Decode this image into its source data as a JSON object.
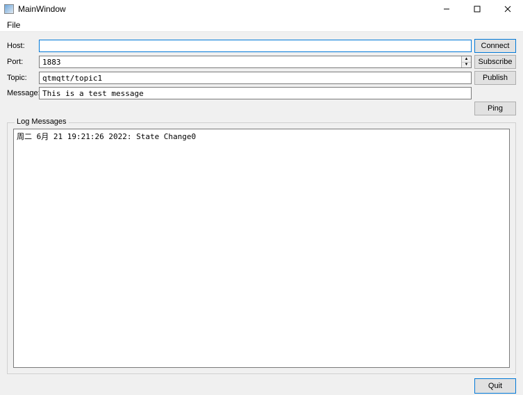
{
  "window": {
    "title": "MainWindow",
    "menu": {
      "file": "File"
    }
  },
  "form": {
    "host": {
      "label": "Host:",
      "value": ""
    },
    "port": {
      "label": "Port:",
      "value": "1883"
    },
    "topic": {
      "label": "Topic:",
      "value": "qtmqtt/topic1"
    },
    "message": {
      "label": "Message:",
      "value": "This is a test message"
    }
  },
  "buttons": {
    "connect": "Connect",
    "subscribe": "Subscribe",
    "publish": "Publish",
    "ping": "Ping",
    "quit": "Quit"
  },
  "log": {
    "legend": "Log Messages",
    "content": "周二 6月 21 19:21:26 2022: State Change0"
  }
}
